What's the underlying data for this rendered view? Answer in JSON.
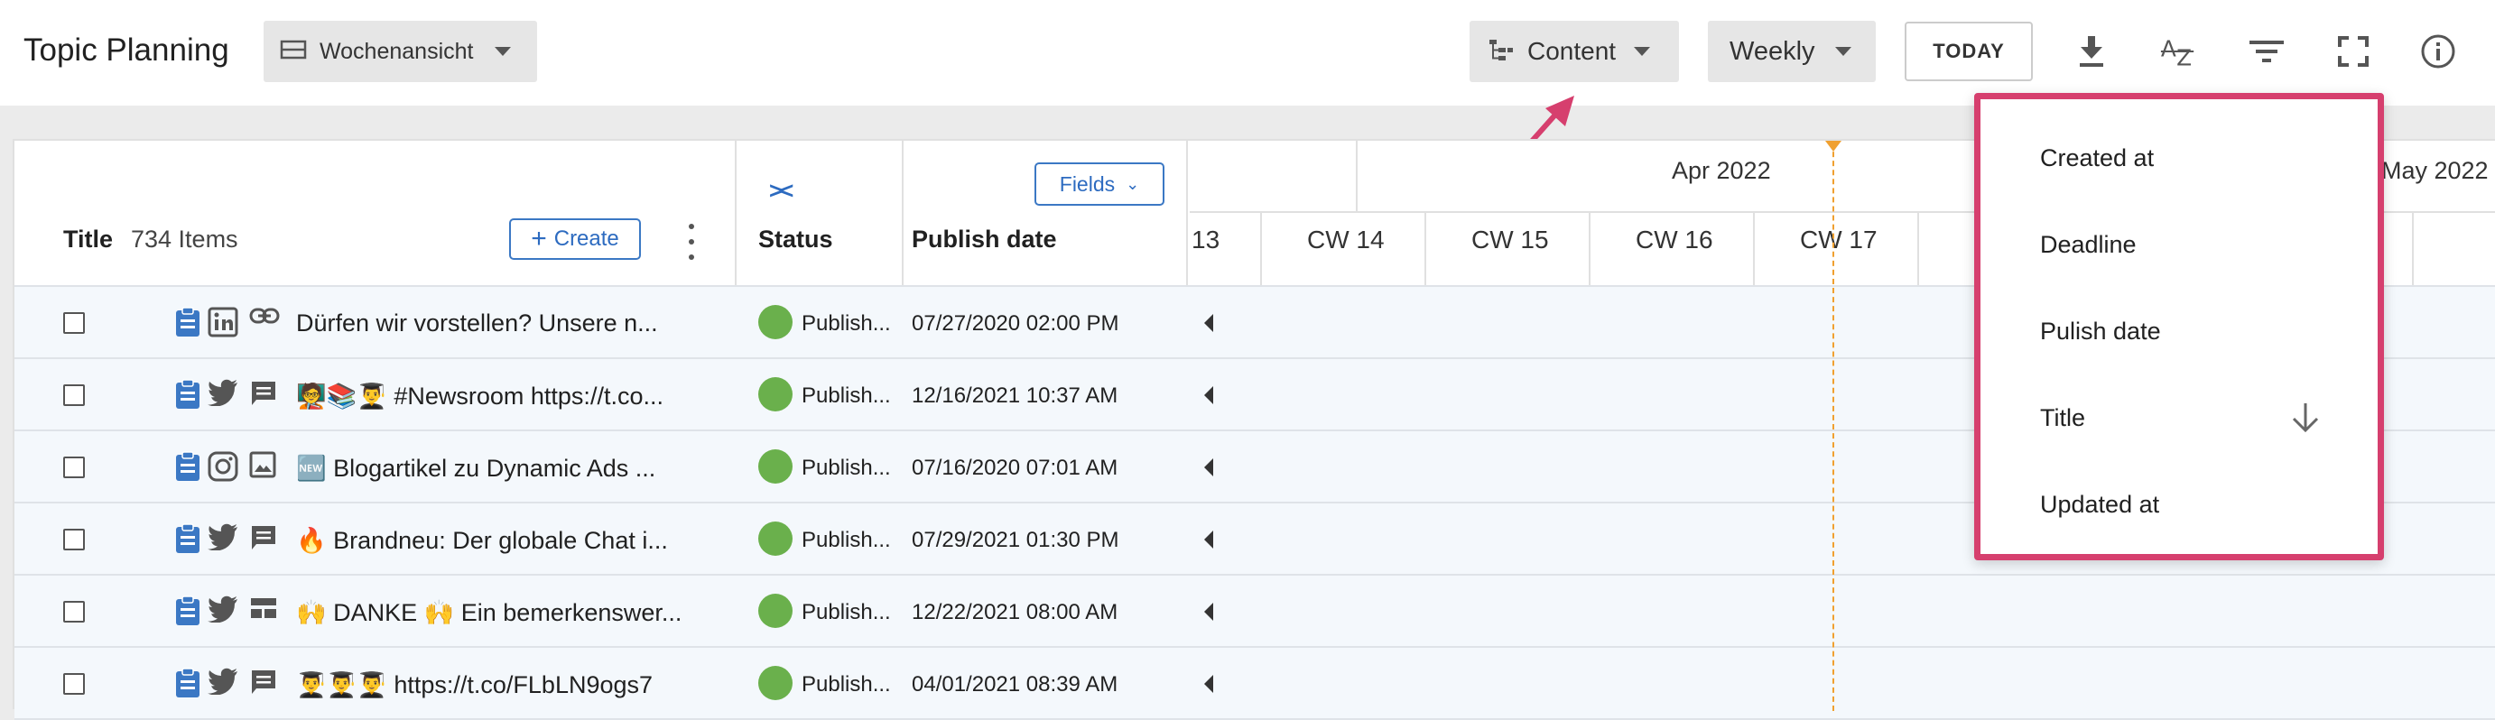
{
  "toolbar": {
    "app_title": "Topic Planning",
    "view_select": "Wochenansicht",
    "content_select": "Content",
    "period_select": "Weekly",
    "today_button": "TODAY"
  },
  "grid": {
    "title_header": "Title",
    "item_count": "734 Items",
    "create_label": "Create",
    "fields_label": "Fields",
    "status_header": "Status",
    "publish_header": "Publish date"
  },
  "timeline": {
    "months": [
      "Apr 2022",
      "May 2022"
    ],
    "weeks": [
      "13",
      "CW 14",
      "CW 15",
      "CW 16",
      "CW 17"
    ]
  },
  "rows": [
    {
      "title": "Dürfen wir vorstellen? Unsere n...",
      "network": "linkedin",
      "format": "link",
      "status": "Publish...",
      "publish_date": "07/27/2020 02:00 PM"
    },
    {
      "title": "🧑‍🏫📚👨‍🎓 #Newsroom https://t.co...",
      "network": "twitter",
      "format": "post",
      "status": "Publish...",
      "publish_date": "12/16/2021 10:37 AM"
    },
    {
      "title": "🆕 Blogartikel zu Dynamic Ads ...",
      "network": "instagram",
      "format": "image",
      "status": "Publish...",
      "publish_date": "07/16/2020 07:01 AM"
    },
    {
      "title": "🔥 Brandneu: Der globale Chat i...",
      "network": "twitter",
      "format": "post",
      "status": "Publish...",
      "publish_date": "07/29/2021 01:30 PM"
    },
    {
      "title": "🙌 DANKE 🙌 Ein bemerkenswer...",
      "network": "twitter",
      "format": "article",
      "status": "Publish...",
      "publish_date": "12/22/2021 08:00 AM"
    },
    {
      "title": "👨‍🎓👨‍🎓👨‍🎓 https://t.co/FLbLN9ogs7",
      "network": "twitter",
      "format": "post",
      "status": "Publish...",
      "publish_date": "04/01/2021 08:39 AM"
    }
  ],
  "sort_menu": {
    "items": [
      "Created at",
      "Deadline",
      "Pulish date",
      "Title",
      "Updated at"
    ],
    "active": "Title",
    "direction": "descending"
  },
  "colors": {
    "accent": "#2d6bc0",
    "status_published": "#6ab04c",
    "today_line": "#f0a030",
    "highlight": "#d63f6e",
    "type_icon": "#3b78c4"
  }
}
